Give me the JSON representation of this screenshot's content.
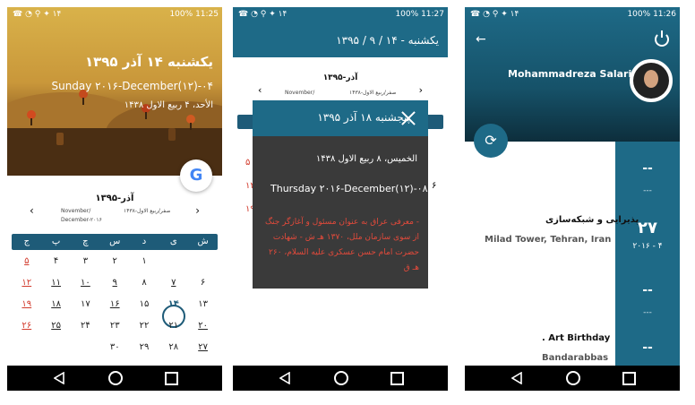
{
  "status": {
    "battery": "100%",
    "times": [
      "11:25",
      "11:27",
      "11:26"
    ],
    "notif_count": "۱۴"
  },
  "screen1": {
    "title": "یکشنبه ۱۴ آذر ۱۳۹۵",
    "gregorian": "Sunday ۲۰۱۶-December(۱۲)-۰۴",
    "hijri": "الأحد، ۴ ربیع الاول ۱۴۳۸",
    "google_label": "G",
    "month_title": "آذر-۱۳۹۵",
    "sub_left1": "November/",
    "sub_left2": "December-۲۰۱۶",
    "sub_right": "صفر/ربیع الاول-۱۴۳۸",
    "weekdays": [
      "ش",
      "ی",
      "د",
      "س",
      "چ",
      "پ",
      "ج"
    ],
    "rows": [
      [
        "",
        "",
        "۱",
        "۲",
        "۳",
        "۴",
        "۵"
      ],
      [
        "۶",
        "۷",
        "۸",
        "۹",
        "۱۰",
        "۱۱",
        "۱۲"
      ],
      [
        "۱۳",
        "۱۴",
        "۱۵",
        "۱۶",
        "۱۷",
        "۱۸",
        "۱۹"
      ],
      [
        "۲۰",
        "۲۱",
        "۲۲",
        "۲۳",
        "۲۴",
        "۲۵",
        "۲۶"
      ],
      [
        "۲۷",
        "۲۸",
        "۲۹",
        "۳۰",
        "",
        "",
        ""
      ]
    ]
  },
  "screen2": {
    "header": "یکشنبه - ۱۴ / ۹ / ۱۳۹۵",
    "month_title": "آذر-۱۳۹۵",
    "sub_left": "November/",
    "sub_right": "صفر/ربیع الاول-۱۴۳۸",
    "dialog_title": "پنجشنبه ۱۸ آذر ۱۳۹۵",
    "dialog_hijri": "الخمیس، ۸ ربیع الاول ۱۴۳۸",
    "dialog_greg": "Thursday ۲۰۱۶-December(۱۲)-۰۸",
    "dialog_event": "- معرفی عراق به عنوان مسئول و آغازگر جنگ از سوی سازمان ملل، ۱۳۷۰ هـ ش - شهادت حضرت امام حسن عسکری علیه السلام، ۲۶۰ هـ ق"
  },
  "screen3": {
    "name": "Mohammadreza Salari",
    "event1_title": "پذیرایی و شبکه‌سازی",
    "event1_loc": "Milad Tower, Tehran, Iran",
    "event1_day": "۲۷",
    "event1_date": "۲۰۱۶ - ۴",
    "event2_title": "Art Birthday .",
    "event2_loc": "Bandarabbas",
    "dash": "--",
    "dash_small": "---"
  }
}
